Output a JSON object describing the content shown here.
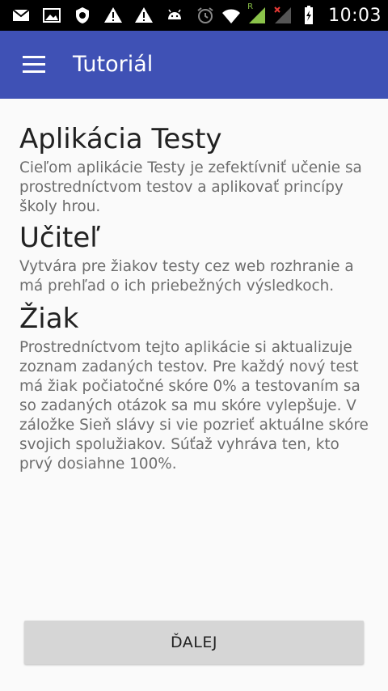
{
  "status_bar": {
    "time": "10:03",
    "icons_left": [
      "mail-icon",
      "image-icon",
      "shield-icon",
      "warning-icon",
      "warning-icon",
      "android-icon"
    ],
    "icons_right": [
      "alarm-icon",
      "wifi-icon",
      "signal-icon",
      "no-signal-icon",
      "battery-charging-icon"
    ],
    "roaming_label": "R"
  },
  "app_bar": {
    "title": "Tutoriál",
    "color": "#3f51b5"
  },
  "content": {
    "sections": [
      {
        "heading": "Aplikácia Testy",
        "text": "Cieľom aplikácie Testy je zefektívniť učenie sa prostredníctvom testov a aplikovať princípy školy hrou."
      },
      {
        "heading": "Učiteľ",
        "text": "Vytvára pre žiakov testy cez web rozhranie a má prehľad o ich priebežných výsledkoch."
      },
      {
        "heading": "Žiak",
        "text": "Prostredníctvom tejto aplikácie si aktualizuje zoznam zadaných testov. Pre každý nový test má žiak počiatočné skóre 0% a testovaním sa so zadaných otázok sa mu skóre vylepšuje. V záložke Sieň slávy si vie pozrieť aktuálne skóre svojich spolužiakov. Súťaž vyhráva ten, kto prvý dosiahne 100%."
      }
    ]
  },
  "next_button": {
    "label": "ĎALEJ"
  }
}
